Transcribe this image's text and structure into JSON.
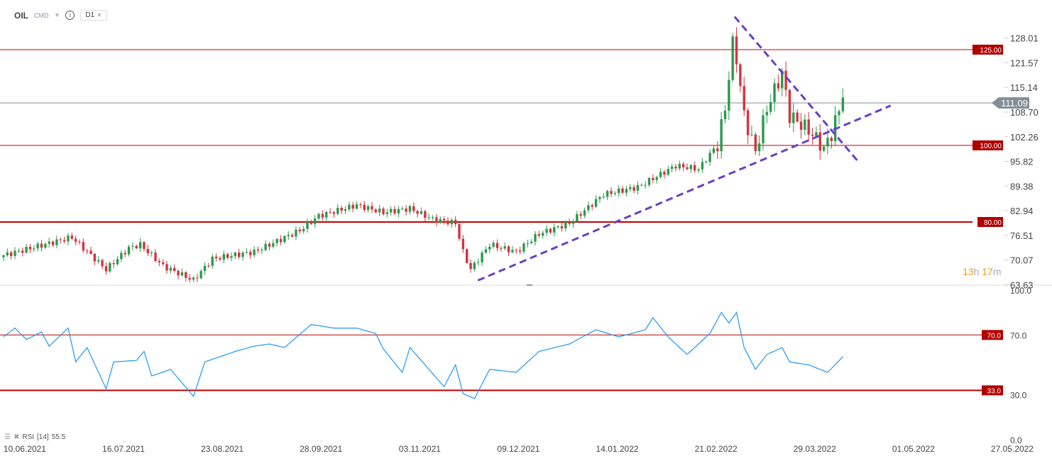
{
  "header": {
    "symbol": "OIL",
    "type": "CMD",
    "timeframe": "D1"
  },
  "timer": {
    "hours": "13",
    "h": "h",
    "minutes": "17",
    "m": "m"
  },
  "indicator": {
    "name": "RSI",
    "period": "[14]",
    "value": "55.5"
  },
  "colors": {
    "up": "#2b9a4b",
    "down": "#d3343f",
    "level": "#c00000",
    "trend": "#6a3fc4",
    "rsi": "#2196f3",
    "current": "#848e96"
  },
  "chart_data": [
    {
      "type": "candlestick",
      "title": "OIL D1",
      "x_tick_labels": [
        "10.06.2021",
        "16.07.2021",
        "23.08.2021",
        "28.09.2021",
        "03.11.2021",
        "09.12.2021",
        "14.01.2022",
        "21.02.2022",
        "29.03.2022",
        "01.05.2022",
        "27.05.2022"
      ],
      "y_tick_labels": [
        "128.01",
        "121.57",
        "115.14",
        "108.70",
        "102.26",
        "95.82",
        "89.38",
        "82.94",
        "76.51",
        "70.07",
        "63.63"
      ],
      "ylim": [
        63.63,
        128.01
      ],
      "bars_per_x_label": 26,
      "close_keypoints": [
        [
          0,
          71.3
        ],
        [
          18,
          76
        ],
        [
          27,
          67.6
        ],
        [
          33,
          73.2
        ],
        [
          36,
          74.1
        ],
        [
          42,
          68.5
        ],
        [
          50,
          64.8
        ],
        [
          55,
          70.4
        ],
        [
          66,
          72.2
        ],
        [
          78,
          77.8
        ],
        [
          83,
          81.6
        ],
        [
          93,
          84.4
        ],
        [
          100,
          82.5
        ],
        [
          107,
          83.5
        ],
        [
          113,
          80.7
        ],
        [
          119,
          79.7
        ],
        [
          121,
          72.2
        ],
        [
          123,
          67.6
        ],
        [
          128,
          74.1
        ],
        [
          135,
          72.2
        ],
        [
          141,
          76.9
        ],
        [
          149,
          79.7
        ],
        [
          158,
          87.2
        ],
        [
          167,
          89.1
        ],
        [
          177,
          94.7
        ],
        [
          183,
          93.8
        ],
        [
          188,
          100.3
        ],
        [
          190,
          109.7
        ],
        [
          192,
          126.5
        ],
        [
          193,
          122.8
        ],
        [
          195,
          107.8
        ],
        [
          198,
          98.4
        ],
        [
          201,
          109.7
        ],
        [
          205,
          119
        ],
        [
          207,
          107.8
        ],
        [
          212,
          104
        ],
        [
          216,
          99.4
        ],
        [
          218,
          103
        ],
        [
          221,
          112.5
        ]
      ],
      "levels": [
        {
          "label": "125.00",
          "value": 125,
          "weight": "thin"
        },
        {
          "label": "100.00",
          "value": 100,
          "weight": "thin"
        },
        {
          "label": "80.00",
          "value": 80,
          "weight": "thick"
        }
      ],
      "current_price": {
        "label": "111.09",
        "value": 111.09
      },
      "trendlines": [
        {
          "from": [
            124.9,
            64.75
          ],
          "to": [
            233.6,
            110.4
          ]
        },
        {
          "from": [
            192.5,
            133.6
          ],
          "to": [
            225.2,
            95.6
          ]
        }
      ]
    },
    {
      "type": "line",
      "title": "RSI [14]",
      "ylim": [
        0,
        100
      ],
      "y_tick_labels": [
        "100.0",
        "70.0",
        "30.0",
        "0.0"
      ],
      "levels": [
        {
          "label": "70.0",
          "value": 70,
          "weight": "thin"
        },
        {
          "label": "33.0",
          "value": 33,
          "weight": "thick"
        }
      ],
      "keypoints": [
        [
          0,
          68.7
        ],
        [
          3,
          74.6
        ],
        [
          6,
          67
        ],
        [
          10,
          72
        ],
        [
          12,
          62.5
        ],
        [
          17,
          74.6
        ],
        [
          19,
          52
        ],
        [
          22,
          61.6
        ],
        [
          27,
          34
        ],
        [
          29,
          52
        ],
        [
          35,
          53
        ],
        [
          37,
          59
        ],
        [
          39,
          42.6
        ],
        [
          44,
          47
        ],
        [
          50,
          29
        ],
        [
          53,
          52
        ],
        [
          61,
          59
        ],
        [
          66,
          62.5
        ],
        [
          70,
          64
        ],
        [
          74,
          61.6
        ],
        [
          81,
          77
        ],
        [
          87,
          74.6
        ],
        [
          93,
          74.6
        ],
        [
          98,
          71
        ],
        [
          100,
          60.7
        ],
        [
          105,
          45
        ],
        [
          107,
          61.6
        ],
        [
          111,
          50
        ],
        [
          116,
          35.5
        ],
        [
          119,
          50
        ],
        [
          121,
          30.8
        ],
        [
          124,
          27.5
        ],
        [
          128,
          47
        ],
        [
          135,
          45
        ],
        [
          141,
          59
        ],
        [
          149,
          64
        ],
        [
          156,
          73.5
        ],
        [
          162,
          68.7
        ],
        [
          169,
          73.5
        ],
        [
          171,
          81.5
        ],
        [
          175,
          68.7
        ],
        [
          180,
          57
        ],
        [
          186,
          71
        ],
        [
          189,
          85
        ],
        [
          191,
          78
        ],
        [
          193,
          85
        ],
        [
          195,
          61.6
        ],
        [
          198,
          47
        ],
        [
          201,
          57
        ],
        [
          205,
          61.6
        ],
        [
          207,
          52
        ],
        [
          212,
          50
        ],
        [
          217,
          45
        ],
        [
          221,
          55.5
        ]
      ]
    }
  ]
}
